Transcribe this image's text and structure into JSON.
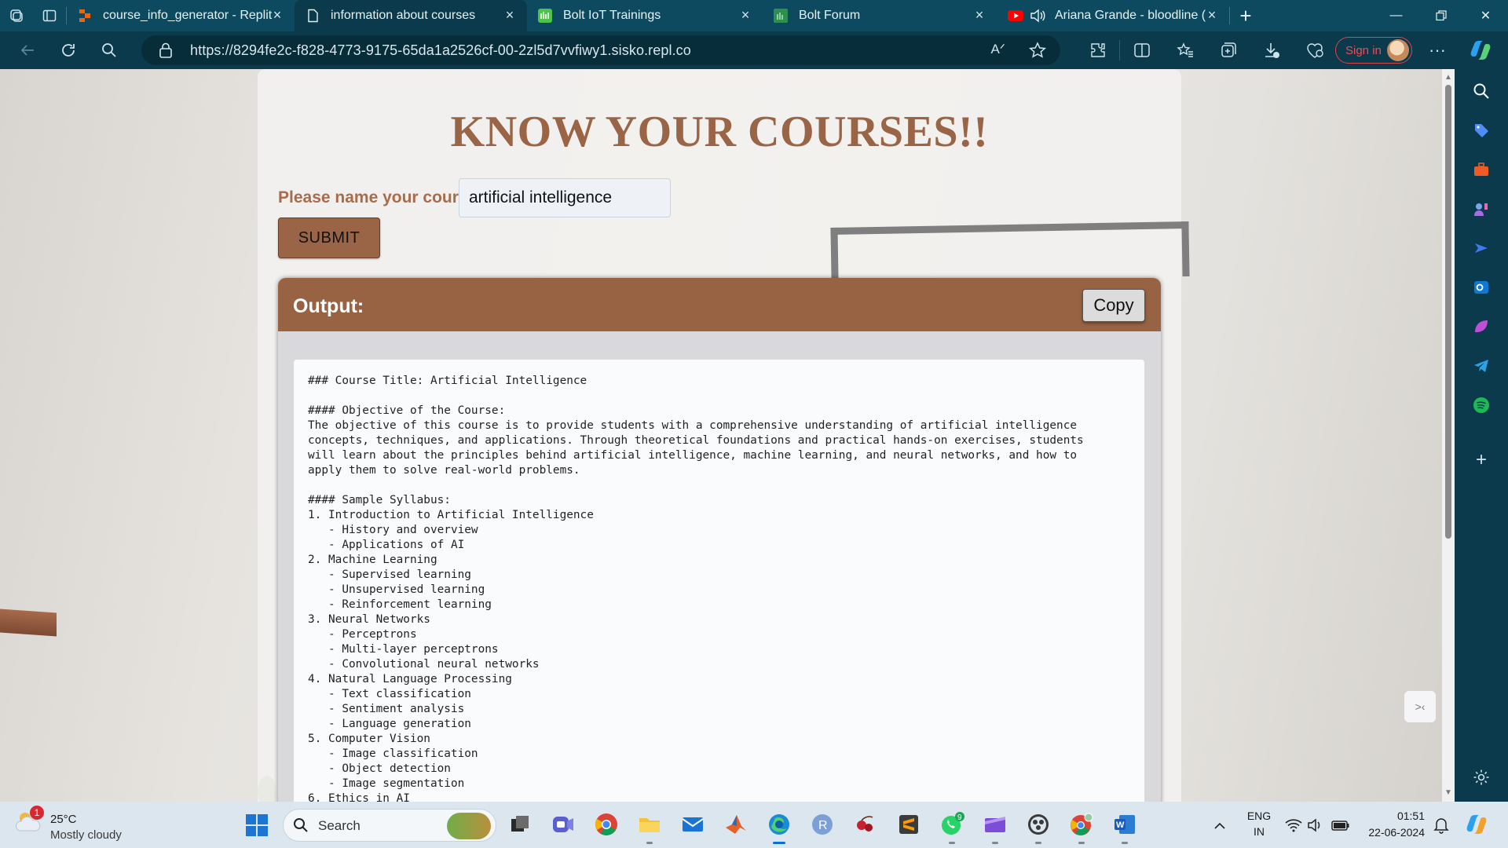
{
  "browser": {
    "tabs": [
      {
        "title": "course_info_generator - Replit",
        "active": false
      },
      {
        "title": "information about courses",
        "active": true
      },
      {
        "title": "Bolt IoT Trainings",
        "active": false
      },
      {
        "title": "Bolt Forum",
        "active": false
      },
      {
        "title": "Ariana Grande - bloodline (",
        "active": false
      }
    ],
    "url": "https://8294fe2c-f828-4773-9175-65da1a2526cf-00-2zl5d7vvfiwy1.sisko.repl.co",
    "sign_in_label": "Sign in"
  },
  "page": {
    "title": "KNOW YOUR COURSES!!",
    "course_label": "Please name your course:",
    "course_value": "artificial intelligence",
    "submit_label": "SUBMIT",
    "output_label": "Output:",
    "copy_label": "Copy",
    "output_text": "### Course Title: Artificial Intelligence\n\n#### Objective of the Course:\nThe objective of this course is to provide students with a comprehensive understanding of artificial intelligence\nconcepts, techniques, and applications. Through theoretical foundations and practical hands-on exercises, students\nwill learn about the principles behind artificial intelligence, machine learning, and neural networks, and how to\napply them to solve real-world problems.\n\n#### Sample Syllabus:\n1. Introduction to Artificial Intelligence\n   - History and overview\n   - Applications of AI\n2. Machine Learning\n   - Supervised learning\n   - Unsupervised learning\n   - Reinforcement learning\n3. Neural Networks\n   - Perceptrons\n   - Multi-layer perceptrons\n   - Convolutional neural networks\n4. Natural Language Processing\n   - Text classification\n   - Sentiment analysis\n   - Language generation\n5. Computer Vision\n   - Image classification\n   - Object detection\n   - Image segmentation\n6. Ethics in AI"
  },
  "taskbar": {
    "weather_temp": "25°C",
    "weather_desc": "Mostly cloudy",
    "weather_badge": "1",
    "search_placeholder": "Search",
    "whatsapp_badge": "9",
    "lang_line1": "ENG",
    "lang_line2": "IN",
    "time": "01:51",
    "date": "22-06-2024"
  },
  "colors": {
    "accent_brown": "#9a6446",
    "browser_teal": "#0a3a4c",
    "signin_red": "#e0424c"
  }
}
